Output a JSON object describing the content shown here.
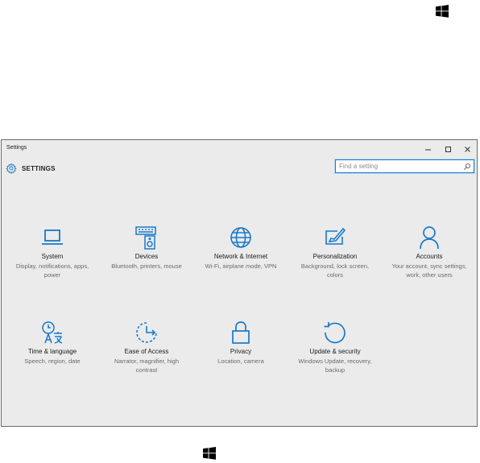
{
  "window": {
    "title": "Settings",
    "controls": {
      "minimize": "–",
      "maximize": "☐",
      "close": "✕"
    }
  },
  "header": {
    "title": "SETTINGS",
    "icon": "gear-icon"
  },
  "search": {
    "placeholder": "Find a setting",
    "value": "",
    "icon": "search-icon"
  },
  "categories": [
    {
      "title": "System",
      "description": "Display, notifications, apps, power",
      "icon": "laptop-icon"
    },
    {
      "title": "Devices",
      "description": "Bluetooth, printers, mouse",
      "icon": "devices-icon"
    },
    {
      "title": "Network & Internet",
      "description": "Wi-Fi, airplane mode, VPN",
      "icon": "globe-icon"
    },
    {
      "title": "Personalization",
      "description": "Background, lock screen, colors",
      "icon": "personalization-icon"
    },
    {
      "title": "Accounts",
      "description": "Your account, sync settings, work, other users",
      "icon": "person-icon"
    },
    {
      "title": "Time & language",
      "description": "Speech, region, date",
      "icon": "time-language-icon"
    },
    {
      "title": "Ease of Access",
      "description": "Narrator, magnifier, high contrast",
      "icon": "ease-of-access-icon"
    },
    {
      "title": "Privacy",
      "description": "Location, camera",
      "icon": "lock-icon"
    },
    {
      "title": "Update & security",
      "description": "Windows Update, recovery, backup",
      "icon": "update-icon"
    }
  ],
  "colors": {
    "accent": "#1979ca",
    "window_background": "#ebebeb",
    "windows_logo": "#000000"
  }
}
